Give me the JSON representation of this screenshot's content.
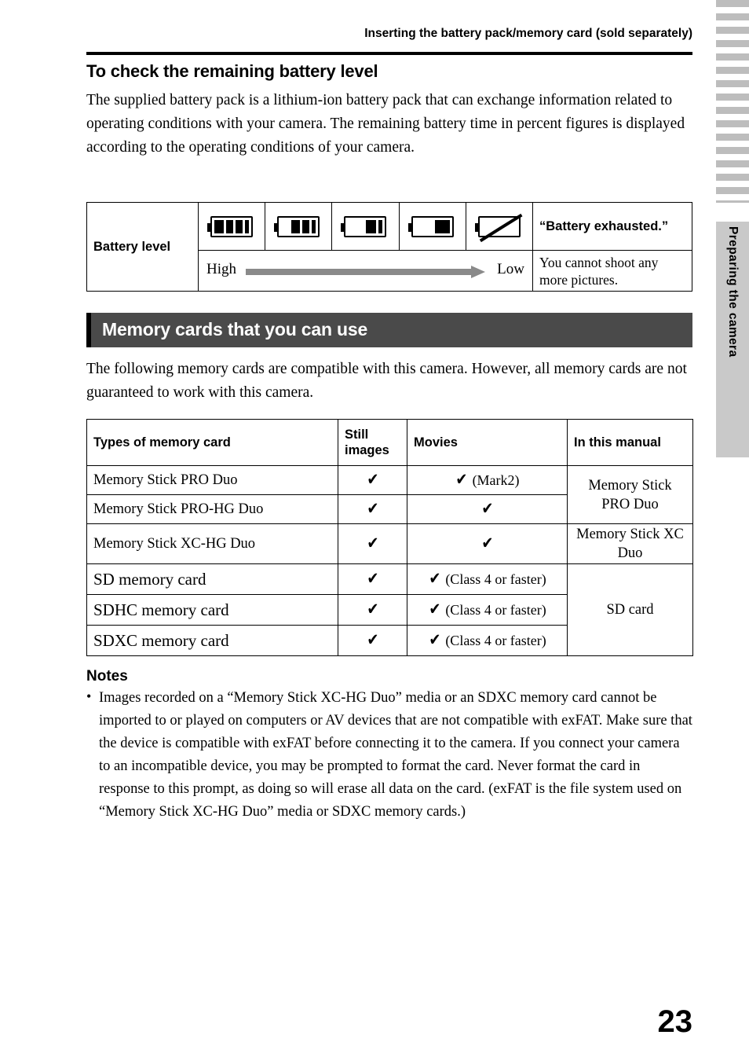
{
  "header": {
    "title": "Inserting the battery pack/memory card (sold separately)"
  },
  "side_tab": {
    "label": "Preparing the camera"
  },
  "sections": {
    "battery_heading": "To check the remaining battery level",
    "battery_intro": "The supplied battery pack is a lithium-ion battery pack that can exchange information related to operating conditions with your camera. The remaining battery time in percent figures is displayed according to the operating conditions of your camera.",
    "memory_banner": "Memory cards that you can use",
    "memory_intro": "The following memory cards are compatible with this camera. However, all memory cards are not guaranteed to work with this camera."
  },
  "battery_table": {
    "row_label": "Battery level",
    "levels": [
      {
        "name": "battery-icon-full",
        "segments": 3,
        "fill": 1.0
      },
      {
        "name": "battery-icon-high",
        "segments": 2,
        "fill": 0.72
      },
      {
        "name": "battery-icon-medium",
        "segments": 1,
        "fill": 0.5
      },
      {
        "name": "battery-icon-low",
        "segments": 0,
        "fill": 0.45
      },
      {
        "name": "battery-icon-exhausted",
        "segments": 0,
        "fill": 0.0
      }
    ],
    "high_label": "High",
    "low_label": "Low",
    "exhausted_label": "“Battery exhausted.”",
    "exhausted_note": "You cannot shoot any more pictures."
  },
  "card_table": {
    "headers": [
      "Types of memory card",
      "Still images",
      "Movies",
      "In this manual"
    ],
    "rows": [
      {
        "type": "Memory Stick PRO Duo",
        "still": "✔",
        "movies": "✔",
        "movies_note": "(Mark2)",
        "manual": "Memory Stick PRO Duo",
        "manual_rowspan": 2,
        "big": false
      },
      {
        "type": "Memory Stick PRO-HG Duo",
        "still": "✔",
        "movies": "✔",
        "movies_note": "",
        "manual": "",
        "manual_rowspan": 0,
        "big": false
      },
      {
        "type": "Memory Stick XC-HG Duo",
        "still": "✔",
        "movies": "✔",
        "movies_note": "",
        "manual": "Memory Stick XC Duo",
        "manual_rowspan": 1,
        "big": false
      },
      {
        "type": "SD memory card",
        "still": "✔",
        "movies": "✔",
        "movies_note": "(Class 4 or faster)",
        "manual": "SD card",
        "manual_rowspan": 3,
        "big": true
      },
      {
        "type": "SDHC memory card",
        "still": "✔",
        "movies": "✔",
        "movies_note": "(Class 4 or faster)",
        "manual": "",
        "manual_rowspan": 0,
        "big": true
      },
      {
        "type": "SDXC memory card",
        "still": "✔",
        "movies": "✔",
        "movies_note": "(Class 4 or faster)",
        "manual": "",
        "manual_rowspan": 0,
        "big": true
      }
    ]
  },
  "notes": {
    "title": "Notes",
    "bullet": "•",
    "text": "Images recorded on a “Memory Stick XC-HG Duo” media or an SDXC memory card cannot be imported to or played on computers or AV devices that are not compatible with exFAT. Make sure that the device is compatible with exFAT before connecting it to the camera. If you connect your camera to an incompatible device, you may be prompted to format the card. Never format the card in response to this prompt, as doing so will erase all data on the card. (exFAT is the file system used on “Memory Stick XC-HG Duo” media or SDXC memory cards.)"
  },
  "page_number": "23"
}
